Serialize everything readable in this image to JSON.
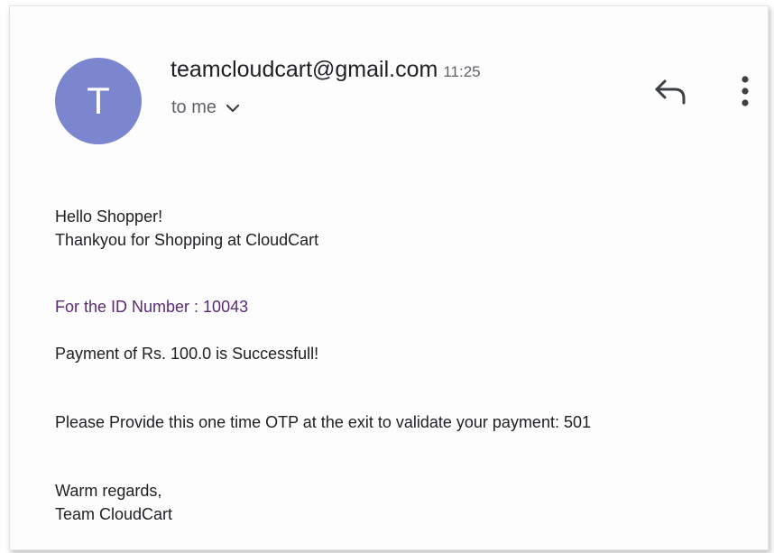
{
  "header": {
    "avatar_letter": "T",
    "sender": "teamcloudcart@gmail.com",
    "time": "11:25",
    "recipient": "to me"
  },
  "icons": {
    "avatar": "avatar-letter-icon",
    "expand_details": "chevron-down-icon",
    "reply": "reply-icon",
    "more": "more-vert-icon"
  },
  "colors": {
    "avatar_bg": "#7b86cf",
    "id_line": "#5b2a74"
  },
  "body": {
    "greeting": "Hello Shopper!",
    "thanks": "Thankyou for Shopping at CloudCart",
    "id_line": "For the ID Number : 10043",
    "payment": "Payment of Rs. 100.0 is Successfull!",
    "otp": "Please Provide this one time OTP at the exit to validate your payment: 501",
    "closing": "Warm regards,",
    "signature": "Team CloudCart"
  }
}
